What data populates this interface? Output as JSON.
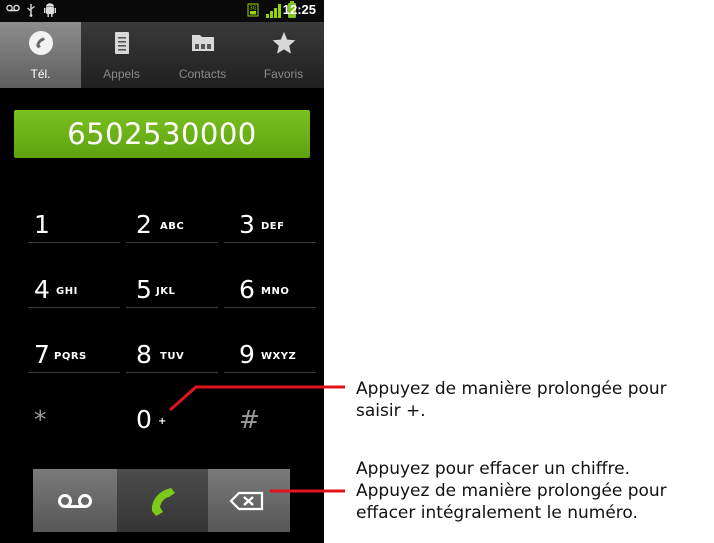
{
  "status_bar": {
    "time": "12:25",
    "icons": [
      "voicemail-icon",
      "usb-icon",
      "android-debug-icon",
      "sim-icon",
      "signal-icon",
      "battery-icon"
    ],
    "signal_color": "#9ad400"
  },
  "tabs": [
    {
      "label": "Tél.",
      "icon": "phone-icon",
      "active": true
    },
    {
      "label": "Appels",
      "icon": "call-log-icon",
      "active": false
    },
    {
      "label": "Contacts",
      "icon": "contacts-icon",
      "active": false
    },
    {
      "label": "Favoris",
      "icon": "star-icon",
      "active": false
    }
  ],
  "digits": "6502530000",
  "digits_color": "#6cb219",
  "keypad": [
    {
      "num": "1",
      "letters": ""
    },
    {
      "num": "2",
      "letters": "ABC"
    },
    {
      "num": "3",
      "letters": "DEF"
    },
    {
      "num": "4",
      "letters": "GHI"
    },
    {
      "num": "5",
      "letters": "JKL"
    },
    {
      "num": "6",
      "letters": "MNO"
    },
    {
      "num": "7",
      "letters": "PQRS"
    },
    {
      "num": "8",
      "letters": "TUV"
    },
    {
      "num": "9",
      "letters": "WXYZ"
    },
    {
      "num": "*",
      "letters": ""
    },
    {
      "num": "0",
      "letters": "+"
    },
    {
      "num": "#",
      "letters": ""
    }
  ],
  "bottom_bar": {
    "left_icon": "voicemail-icon",
    "center_icon": "call-icon",
    "right_icon": "backspace-icon",
    "call_color": "#7dc91b"
  },
  "annotations": {
    "zero_long_press": [
      "Appuyez de manière prolongée pour",
      "saisir +."
    ],
    "backspace": [
      "Appuyez pour effacer un chiffre.",
      "Appuyez de manière prolongée pour",
      "effacer intégralement le numéro."
    ],
    "line_color": "#e0141b"
  }
}
